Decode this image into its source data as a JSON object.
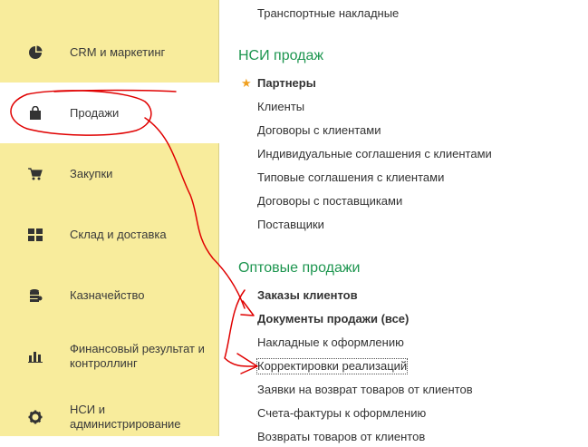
{
  "sidebar": {
    "items": [
      {
        "label": "CRM и маркетинг",
        "icon": "pie-chart-icon"
      },
      {
        "label": "Продажи",
        "icon": "shopping-bag-icon",
        "active": true
      },
      {
        "label": "Закупки",
        "icon": "shopping-cart-icon"
      },
      {
        "label": "Склад и доставка",
        "icon": "warehouse-grid-icon"
      },
      {
        "label": "Казначейство",
        "icon": "coins-stack-icon"
      },
      {
        "label": "Финансовый результат и контроллинг",
        "icon": "bar-chart-icon"
      },
      {
        "label": "НСИ и администрирование",
        "icon": "gear-icon"
      }
    ]
  },
  "content": {
    "top_link": "Транспортные накладные",
    "nsi_group": {
      "title": "НСИ продаж",
      "links": [
        "Партнеры",
        "Клиенты",
        "Договоры с клиентами",
        "Индивидуальные соглашения с клиентами",
        "Типовые соглашения с клиентами",
        "Договоры с поставщиками",
        "Поставщики"
      ]
    },
    "wholesale_group": {
      "title": "Оптовые продажи",
      "links": [
        "Заказы клиентов",
        "Документы продажи (все)",
        "Накладные к оформлению",
        "Корректировки реализаций",
        "Заявки на возврат товаров от клиентов",
        "Счета-фактуры к оформлению",
        "Возвраты товаров от клиентов"
      ]
    }
  },
  "colors": {
    "sidebar_bg": "#f8ec9c",
    "group_title": "#1e9650",
    "favorite_star": "#f0a020",
    "annotation": "#e00000"
  }
}
